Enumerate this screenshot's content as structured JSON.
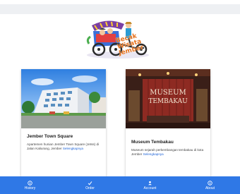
{
  "header": {
    "logo_text_line1": "Becak",
    "logo_text_line2": "Wisata",
    "logo_text_line3": "Jember"
  },
  "cards": [
    {
      "title": "Jember Town Square",
      "description": "Apartemen hunian Jember Town Square (Jetss) di Jalan Kaliurang, Jember",
      "link_text": "Selengkapnya",
      "image_icon": "building-photo"
    },
    {
      "title": "Museum Tembakau",
      "description": "Museum sejarah perkembangan tembakau di kota Jember",
      "link_text": "Selengkapnya",
      "image_icon": "museum-photo",
      "image_sign_line1": "MUSEUM",
      "image_sign_line2": "TEMBAKAU"
    }
  ],
  "bottom_nav": {
    "items": [
      {
        "label": "History",
        "icon": "info-icon"
      },
      {
        "label": "Order",
        "icon": "check-icon"
      },
      {
        "label": "Account",
        "icon": "user-icon"
      },
      {
        "label": "About",
        "icon": "info-icon"
      }
    ]
  },
  "colors": {
    "nav_bg": "#2f78e6",
    "link": "#1e63d6",
    "logo_orange": "#e6731f"
  }
}
